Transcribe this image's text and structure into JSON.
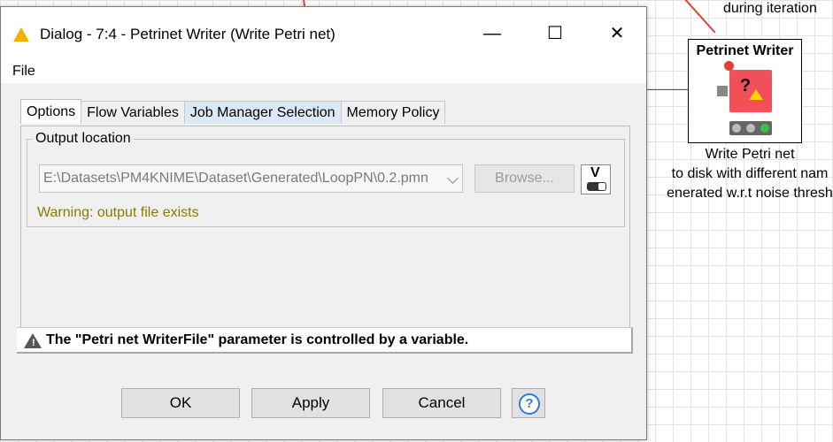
{
  "canvas": {
    "node_note_top": "during iteration",
    "node": {
      "title": "Petrinet Writer",
      "description_lines": [
        "Write Petri net",
        "to disk with different nam",
        "enerated w.r.t noise thresh"
      ]
    }
  },
  "dialog": {
    "title": "Dialog - 7:4 - Petrinet Writer (Write Petri net)",
    "window_buttons": {
      "minimize": "—",
      "maximize": "☐",
      "close": "✕"
    },
    "menu": {
      "file": "File"
    },
    "tabs": [
      {
        "label": "Options",
        "active": true
      },
      {
        "label": "Flow Variables",
        "active": false
      },
      {
        "label": "Job Manager Selection",
        "active": false
      },
      {
        "label": "Memory Policy",
        "active": false
      }
    ],
    "output_location": {
      "group_label": "Output location",
      "path_value": "E:\\Datasets\\PM4KNIME\\Dataset\\Generated\\LoopPN\\0.2.pmn",
      "browse_label": "Browse...",
      "variable_button_label": "V",
      "warning": "Warning: output file exists"
    },
    "status_message": "The \"Petri net WriterFile\" parameter is controlled by a variable.",
    "buttons": {
      "ok": "OK",
      "apply": "Apply",
      "cancel": "Cancel",
      "help": "?"
    }
  },
  "colors": {
    "node_icon": "#f25058",
    "warning_text": "#8a7a00",
    "title_icon": "#f4b000",
    "help_icon": "#2a7fd4"
  }
}
